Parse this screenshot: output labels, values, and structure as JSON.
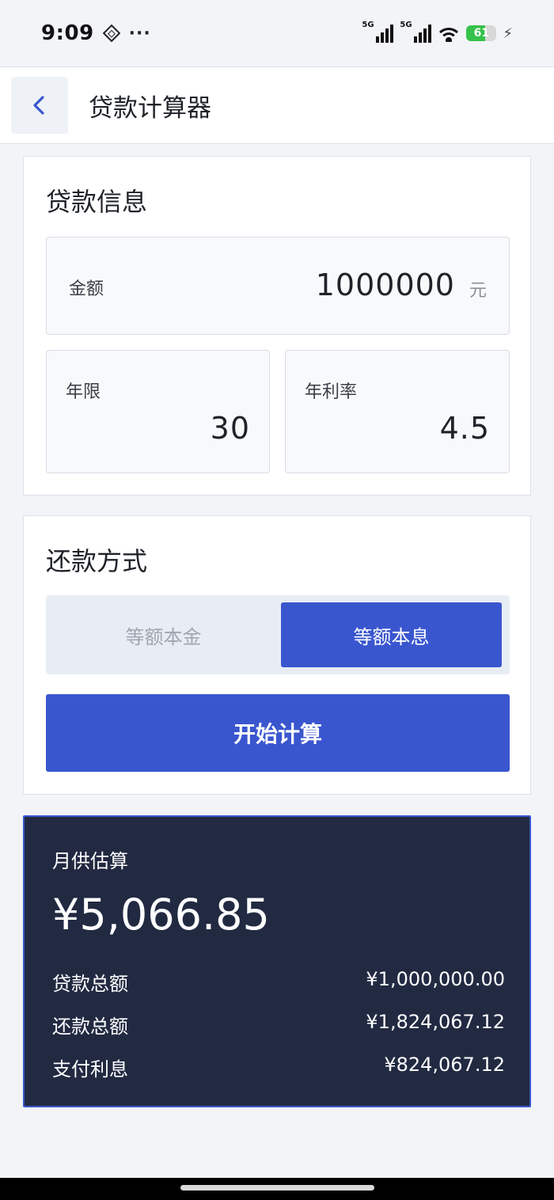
{
  "status_bar": {
    "time": "9:09",
    "dots": "···",
    "signal1_label": "5G",
    "signal2_label": "5G",
    "battery_level": "61",
    "battery_fraction": 0.61,
    "battery_color": "#35c24a"
  },
  "header": {
    "title": "贷款计算器"
  },
  "loan_info": {
    "title": "贷款信息",
    "amount_label": "金额",
    "amount_value": "1000000",
    "amount_unit": "元",
    "years_label": "年限",
    "years_value": "30",
    "rate_label": "年利率",
    "rate_value": "4.5"
  },
  "repayment": {
    "title": "还款方式",
    "options": [
      "等额本金",
      "等额本息"
    ],
    "selected_index": 1,
    "calculate_button": "开始计算"
  },
  "result": {
    "label": "月供估算",
    "monthly_payment": "¥5,066.85",
    "rows": [
      {
        "label": "贷款总额",
        "value": "¥1,000,000.00"
      },
      {
        "label": "还款总额",
        "value": "¥1,824,067.12"
      },
      {
        "label": "支付利息",
        "value": "¥824,067.12"
      }
    ]
  },
  "colors": {
    "accent": "#3a56cf",
    "result_background": "#222a42",
    "page_background": "#f2f4f8"
  }
}
